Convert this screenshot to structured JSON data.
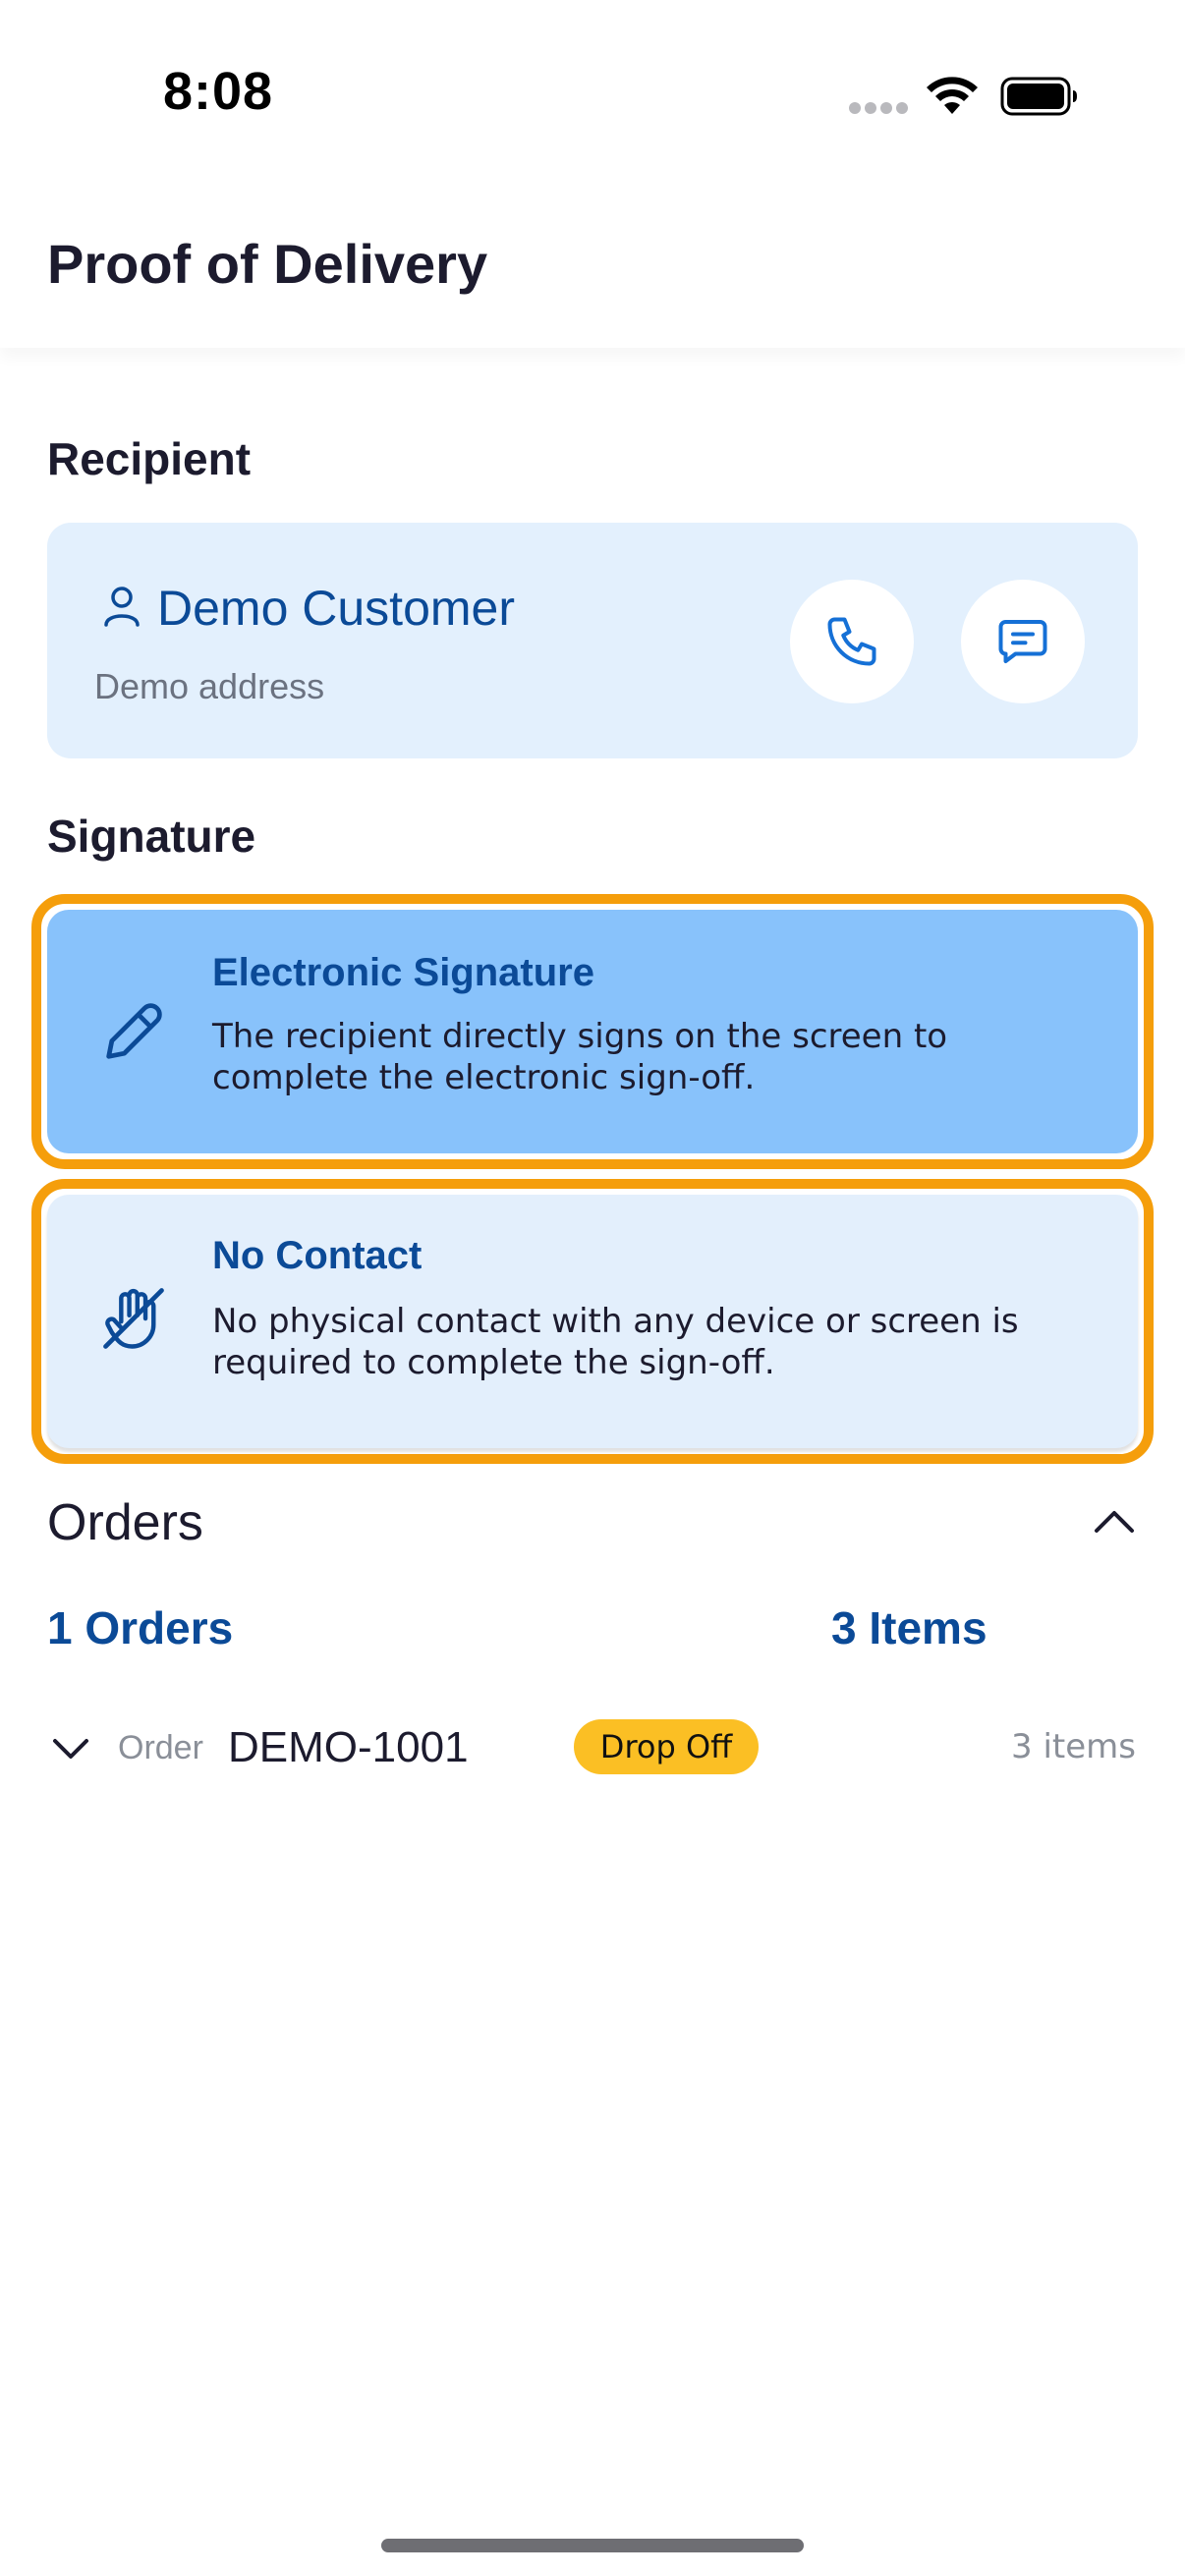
{
  "status_bar": {
    "time": "8:08"
  },
  "header": {
    "title": "Proof of Delivery"
  },
  "recipient": {
    "section_title": "Recipient",
    "name": "Demo Customer",
    "address": "Demo address"
  },
  "signature": {
    "section_title": "Signature",
    "options": [
      {
        "title": "Electronic Signature",
        "description": "The recipient directly signs on the screen to complete the electronic sign-off.",
        "selected": true
      },
      {
        "title": "No Contact",
        "description": "No physical contact with any device or screen is required to complete the sign-off.",
        "selected": false
      }
    ]
  },
  "orders": {
    "section_title": "Orders",
    "orders_count": "1 Orders",
    "items_count": "3 Items",
    "list": [
      {
        "label": "Order",
        "id": "DEMO-1001",
        "badge": "Drop Off",
        "items": "3 items"
      }
    ]
  },
  "colors": {
    "accent": "#0b4a97",
    "highlight": "#f59e0b",
    "selected_bg": "#88c2fb",
    "card_bg": "#e3f0fd",
    "badge": "#fbbf24"
  }
}
